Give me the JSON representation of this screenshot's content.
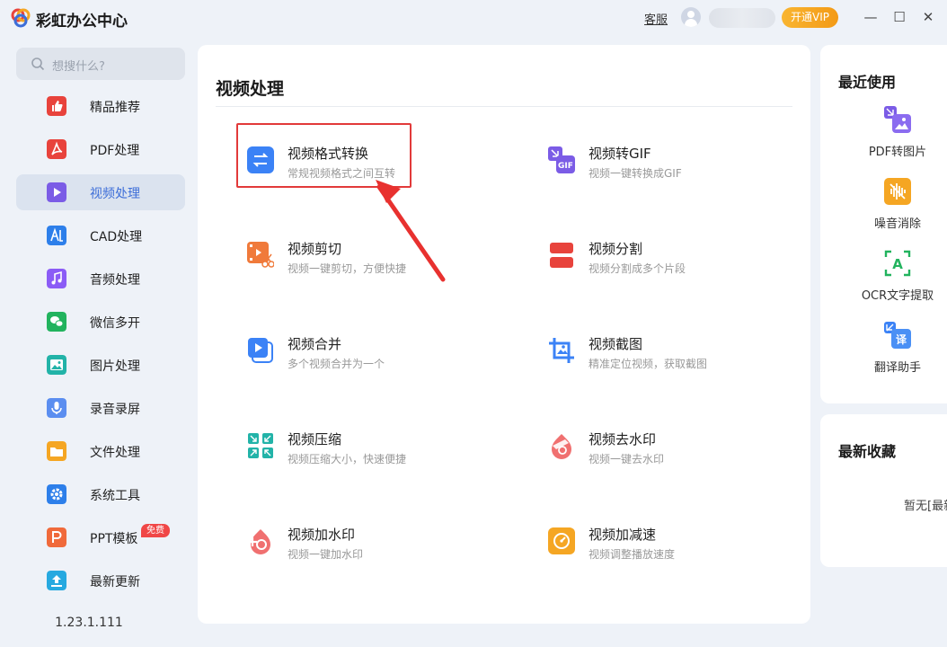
{
  "app": {
    "title": "彩虹办公中心"
  },
  "titlebar": {
    "service_label": "客服",
    "vip_label": "开通VIP"
  },
  "search": {
    "placeholder": "想搜什么?"
  },
  "sidebar": {
    "items": [
      {
        "label": "精品推荐",
        "icon": "thumb-icon",
        "color": "#e8433c"
      },
      {
        "label": "PDF处理",
        "icon": "pdf-icon",
        "color": "#e8433c"
      },
      {
        "label": "视频处理",
        "icon": "video-icon",
        "color": "#7b5ce6",
        "active": true
      },
      {
        "label": "CAD处理",
        "icon": "cad-icon",
        "color": "#2d7fea"
      },
      {
        "label": "音频处理",
        "icon": "music-icon",
        "color": "#8b5cf6"
      },
      {
        "label": "微信多开",
        "icon": "wechat-icon",
        "color": "#22b35e"
      },
      {
        "label": "图片处理",
        "icon": "image-icon",
        "color": "#22b3a8"
      },
      {
        "label": "录音录屏",
        "icon": "mic-icon",
        "color": "#5b8ef0"
      },
      {
        "label": "文件处理",
        "icon": "folder-icon",
        "color": "#f5a623"
      },
      {
        "label": "系统工具",
        "icon": "gear-icon",
        "color": "#2d7fea"
      },
      {
        "label": "PPT模板",
        "icon": "ppt-icon",
        "color": "#f06a3b",
        "badge": "免费"
      },
      {
        "label": "最新更新",
        "icon": "upload-icon",
        "color": "#26a9e0"
      }
    ],
    "version": "1.23.1.111"
  },
  "main": {
    "title": "视频处理",
    "tools": [
      {
        "name": "视频格式转换",
        "desc": "常规视频格式之间互转",
        "icon": "convert-icon"
      },
      {
        "name": "视频转GIF",
        "desc": "视频一键转换成GIF",
        "icon": "gif-icon"
      },
      {
        "name": "视频剪切",
        "desc": "视频一键剪切，方便快捷",
        "icon": "scissors-icon"
      },
      {
        "name": "视频分割",
        "desc": "视频分割成多个片段",
        "icon": "split-icon"
      },
      {
        "name": "视频合并",
        "desc": "多个视频合并为一个",
        "icon": "merge-icon"
      },
      {
        "name": "视频截图",
        "desc": "精准定位视频，获取截图",
        "icon": "crop-icon"
      },
      {
        "name": "视频压缩",
        "desc": "视频压缩大小，快速便捷",
        "icon": "compress-icon"
      },
      {
        "name": "视频去水印",
        "desc": "视频一键去水印",
        "icon": "eraser-icon"
      },
      {
        "name": "视频加水印",
        "desc": "视频一键加水印",
        "icon": "stamp-icon"
      },
      {
        "name": "视频加减速",
        "desc": "视频调整播放速度",
        "icon": "speed-icon"
      }
    ]
  },
  "recent": {
    "title": "最近使用",
    "items": [
      {
        "label": "PDF转图片",
        "icon": "pdf-to-image-icon"
      },
      {
        "label": "噪音消除",
        "icon": "noise-icon"
      },
      {
        "label": "OCR文字提取",
        "icon": "ocr-icon"
      },
      {
        "label": "翻译助手",
        "icon": "translate-icon"
      }
    ]
  },
  "favorites": {
    "title": "最新收藏",
    "empty_text": "暂无[最新收藏]"
  }
}
